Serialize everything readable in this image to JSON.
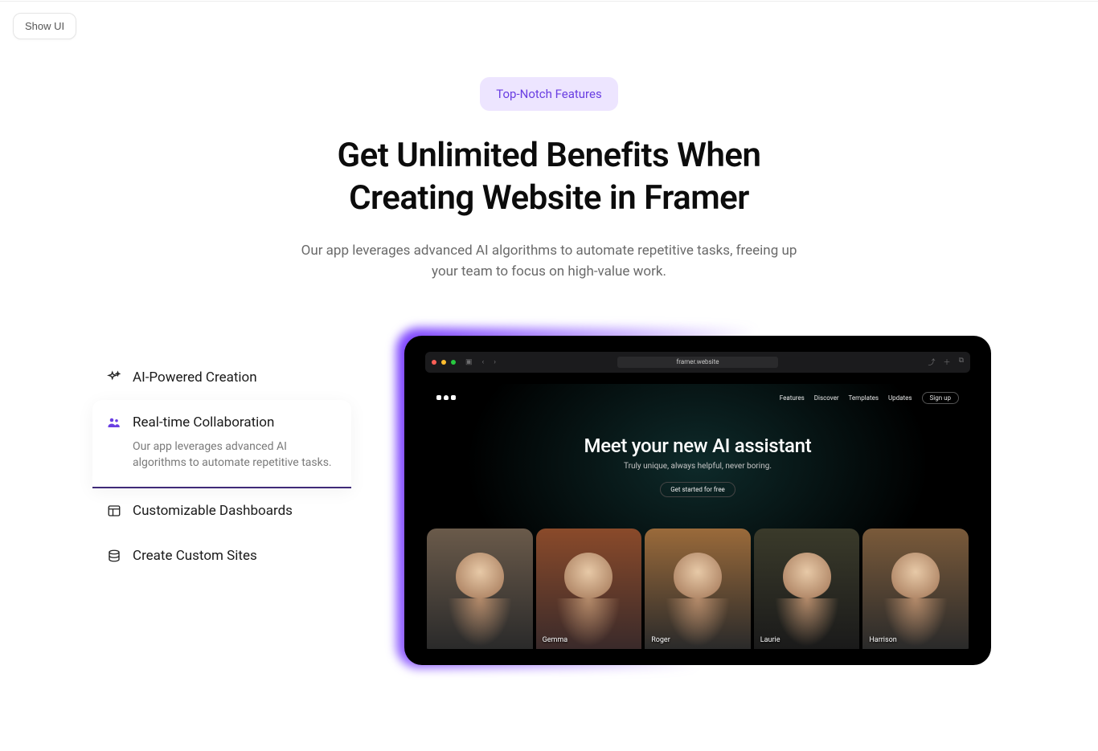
{
  "showUi": "Show UI",
  "badge": "Top-Notch Features",
  "heading_line1": "Get Unlimited Benefits When",
  "heading_line2": "Creating Website in Framer",
  "subheading": "Our app leverages advanced AI algorithms to automate repetitive tasks, freeing up your team to focus on high-value work.",
  "tabs": [
    {
      "label": "AI-Powered Creation"
    },
    {
      "label": "Real-time Collaboration",
      "desc": "Our app leverages advanced AI algorithms to automate repetitive tasks."
    },
    {
      "label": "Customizable Dashboards"
    },
    {
      "label": "Create Custom Sites"
    }
  ],
  "preview": {
    "url": "framer.website",
    "nav": [
      "Features",
      "Discover",
      "Templates",
      "Updates"
    ],
    "signup": "Sign up",
    "heroTitle": "Meet your new AI assistant",
    "heroSub": "Truly unique, always helpful, never boring.",
    "cta": "Get started for free",
    "people": [
      "Gemma",
      "Roger",
      "Laurie",
      "Harrison"
    ]
  }
}
